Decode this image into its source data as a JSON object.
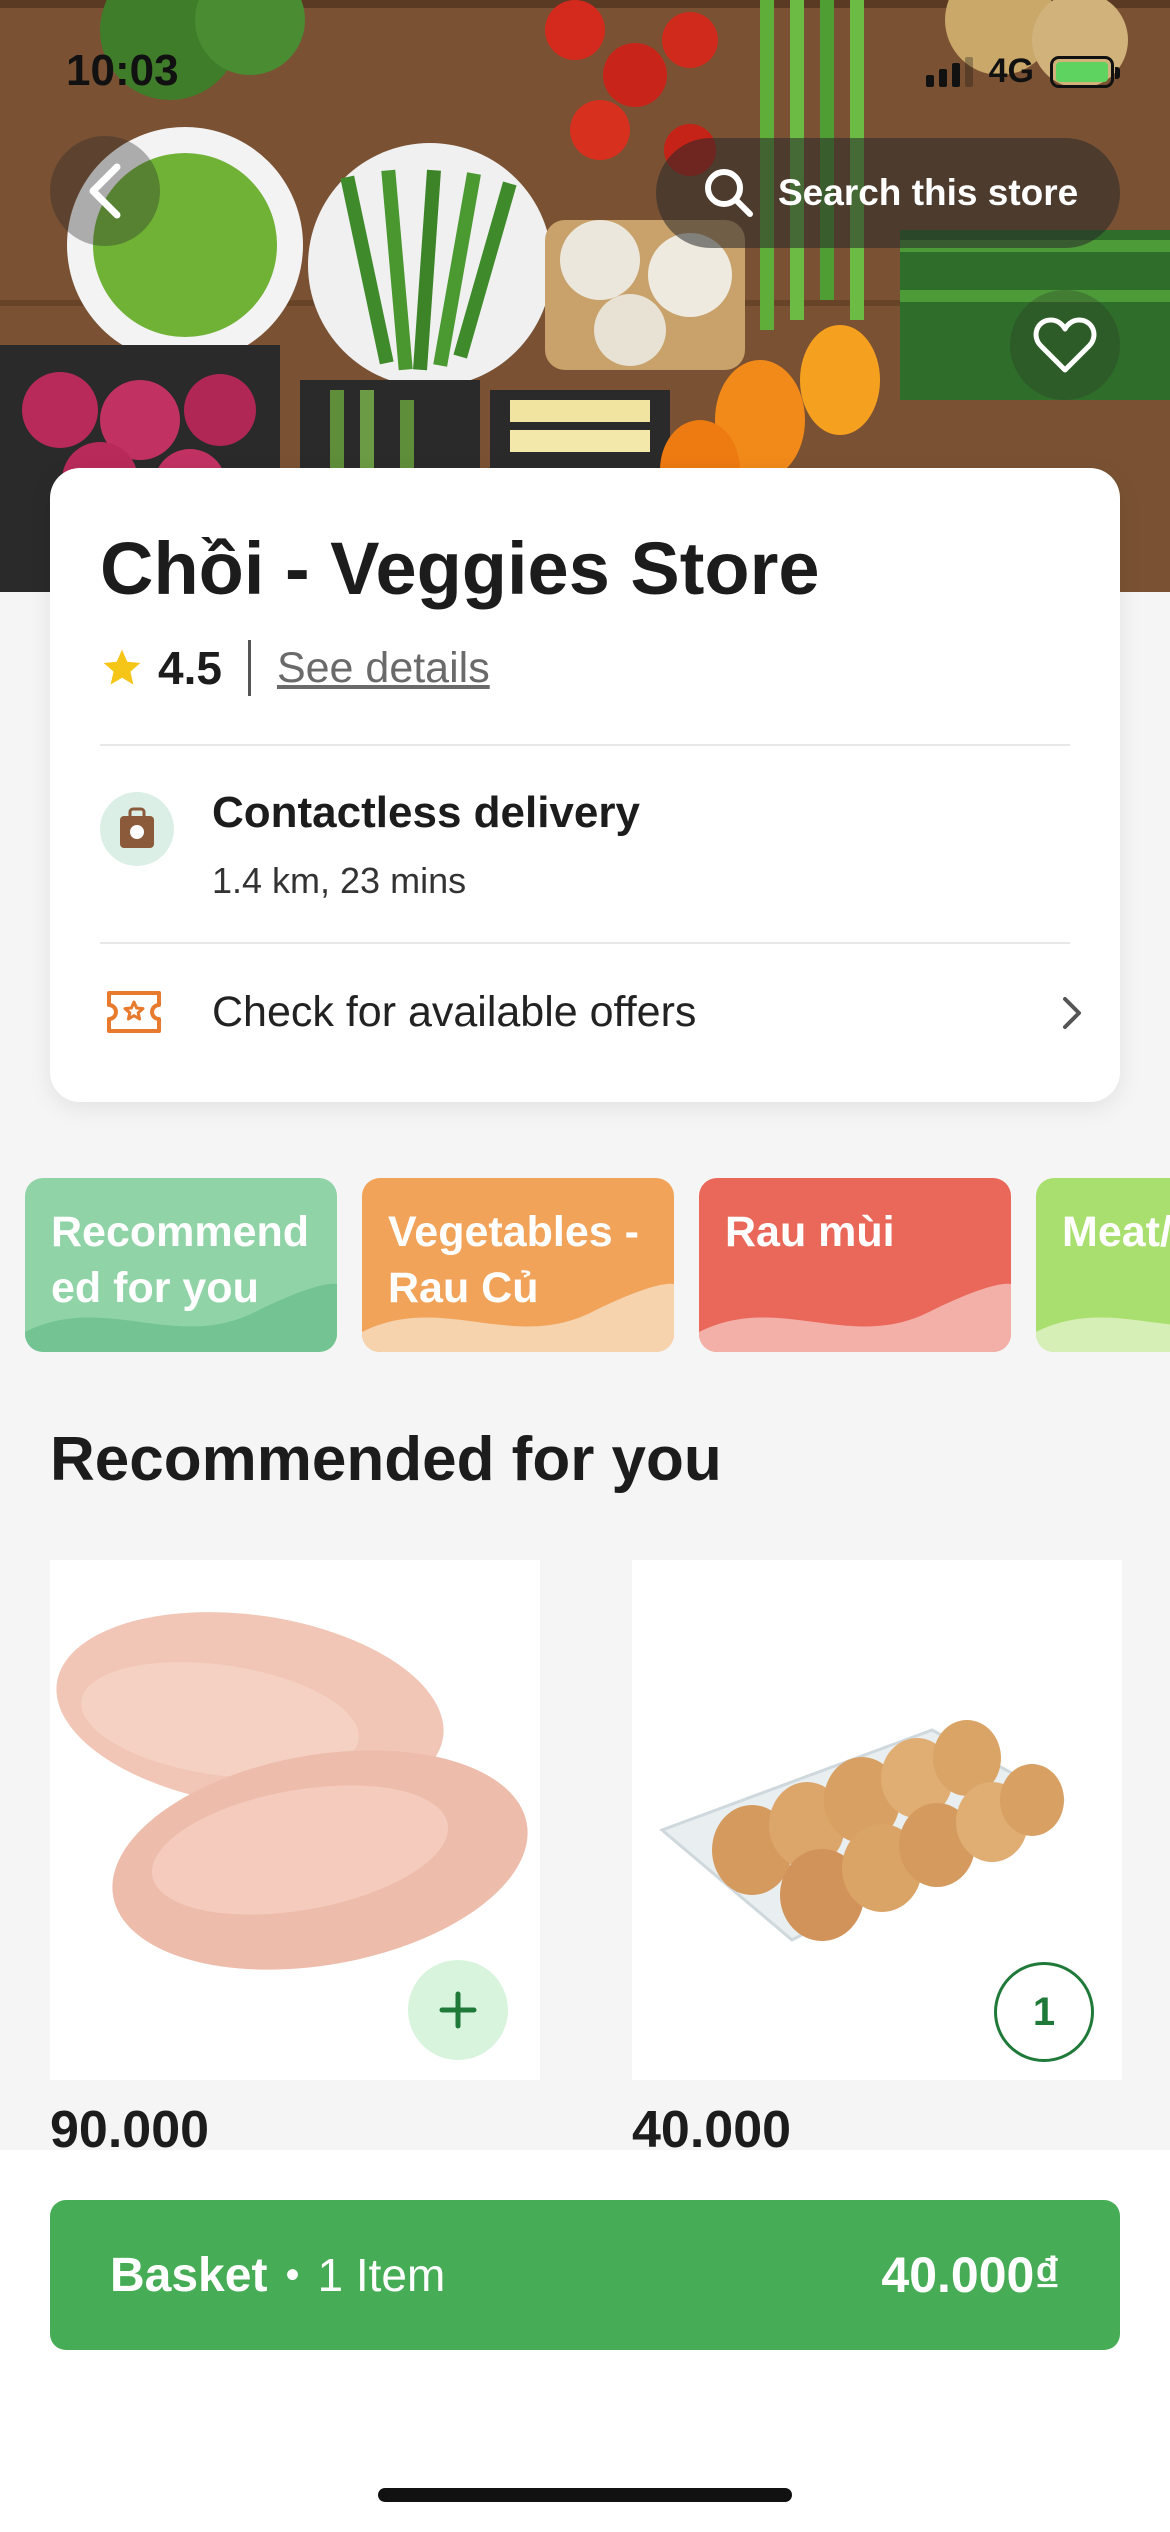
{
  "status_bar": {
    "time": "10:03",
    "network": "4G"
  },
  "header": {
    "search_placeholder": "Search this store"
  },
  "store": {
    "name": "Chồi - Veggies Store",
    "rating": "4.5",
    "see_details": "See details",
    "delivery_title": "Contactless delivery",
    "delivery_info": "1.4 km, 23 mins",
    "offers_text": "Check for available offers"
  },
  "categories": [
    {
      "label": "Recommend ed for you",
      "color": "#8fd3a6"
    },
    {
      "label": "Vegetables - Rau Củ",
      "color": "#f2a35a"
    },
    {
      "label": "Rau mùi",
      "color": "#e9685a"
    },
    {
      "label": "Meat/ Thịt T",
      "color": "#a9df6e"
    }
  ],
  "section_title": "Recommended for you",
  "products": [
    {
      "price": "90.000",
      "action": "+"
    },
    {
      "price": "40.000",
      "quantity": "1"
    }
  ],
  "basket": {
    "label": "Basket",
    "dot": "•",
    "count": "1 Item",
    "total": "40.000₫"
  },
  "colors": {
    "accent_green": "#46ac55",
    "dark_green": "#1f7a3a"
  }
}
